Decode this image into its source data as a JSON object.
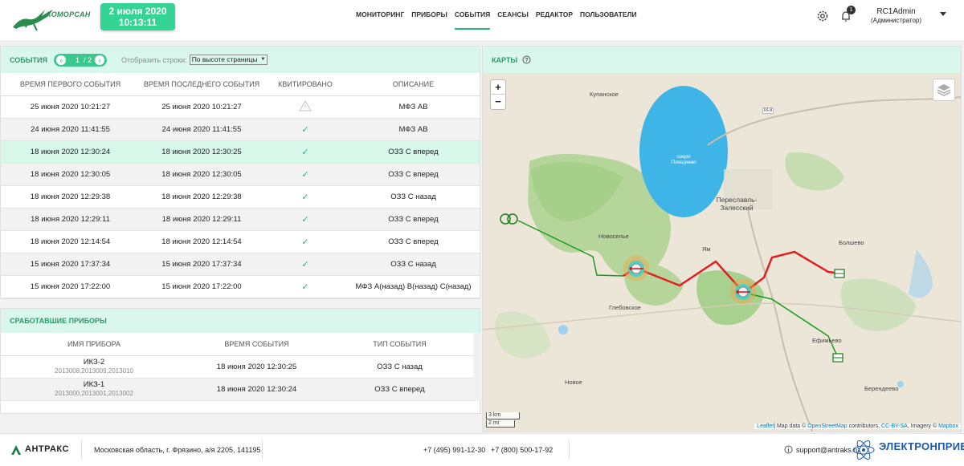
{
  "header": {
    "brand": "КОМОРСАН",
    "date": "2 июля 2020",
    "time": "10:13:11",
    "nav": [
      "МОНИТОРИНГ",
      "ПРИБОРЫ",
      "СОБЫТИЯ",
      "СЕАНСЫ",
      "РЕДАКТОР",
      "ПОЛЬЗОВАТЕЛИ"
    ],
    "notifications": "1",
    "user_name": "RC1Admin",
    "user_role": "(Администратор)"
  },
  "events": {
    "title": "СОБЫТИЯ",
    "page": "1",
    "pages": "/ 2",
    "show_label": "Отобразить строки:",
    "show_value": "По высоте страницы",
    "columns": [
      "ВРЕМЯ ПЕРВОГО СОБЫТИЯ",
      "ВРЕМЯ ПОСЛЕДНЕГО СОБЫТИЯ",
      "КВИТИРОВАНО",
      "ОПИСАНИЕ"
    ],
    "rows": [
      {
        "first": "25 июня 2020 10:21:27",
        "last": "25 июня 2020 10:21:27",
        "ack": "warn",
        "desc": "МФЗ АВ"
      },
      {
        "first": "24 июня 2020 11:41:55",
        "last": "24 июня 2020 11:41:55",
        "ack": "✓",
        "desc": "МФЗ АВ"
      },
      {
        "first": "18 июня 2020 12:30:24",
        "last": "18 июня 2020 12:30:25",
        "ack": "✓",
        "desc": "ОЗЗ С вперед"
      },
      {
        "first": "18 июня 2020 12:30:05",
        "last": "18 июня 2020 12:30:05",
        "ack": "✓",
        "desc": "ОЗЗ С вперед"
      },
      {
        "first": "18 июня 2020 12:29:38",
        "last": "18 июня 2020 12:29:38",
        "ack": "✓",
        "desc": "ОЗЗ С назад"
      },
      {
        "first": "18 июня 2020 12:29:11",
        "last": "18 июня 2020 12:29:11",
        "ack": "✓",
        "desc": "ОЗЗ С вперед"
      },
      {
        "first": "18 июня 2020 12:14:54",
        "last": "18 июня 2020 12:14:54",
        "ack": "✓",
        "desc": "ОЗЗ С вперед"
      },
      {
        "first": "15 июня 2020 17:37:34",
        "last": "15 июня 2020 17:37:34",
        "ack": "✓",
        "desc": "ОЗЗ С назад"
      },
      {
        "first": "15 июня 2020 17:22:00",
        "last": "15 июня 2020 17:22:00",
        "ack": "✓",
        "desc": "МФЗ А(назад) В(назад) С(назад)"
      }
    ]
  },
  "devices": {
    "title": "СРАБОТАВШИЕ ПРИБОРЫ",
    "columns": [
      "ИМЯ ПРИБОРА",
      "ВРЕМЯ СОБЫТИЯ",
      "ТИП СОБЫТИЯ"
    ],
    "rows": [
      {
        "name": "ИКЗ-2",
        "ids": "2013008,2013009,2013010",
        "time": "18 июня 2020 12:30:25",
        "type": "ОЗЗ С назад"
      },
      {
        "name": "ИКЗ-1",
        "ids": "2013000,2013001,2013002",
        "time": "18 июня 2020 12:30:24",
        "type": "ОЗЗ С вперед"
      }
    ]
  },
  "map": {
    "title": "КАРТЫ",
    "zoom_in": "+",
    "zoom_out": "−",
    "labels": [
      "Купанское",
      "озеро Плещеево",
      "Переславль-Залесский",
      "Новоселье",
      "Ям",
      "Болшево",
      "Глебовское",
      "Ефимьево",
      "Новое",
      "Берендеево",
      "М-8"
    ],
    "scale_km": "3 km",
    "scale_mi": "2 mi",
    "attr_leaflet": "Leaflet",
    "attr_text": "| Map data © ",
    "attr_osm": "OpenStreetMap",
    "attr_contrib": " contributors, ",
    "attr_cc": "CC-BY-SA",
    "attr_imagery": ", Imagery © ",
    "attr_mapbox": "Mapbox"
  },
  "footer": {
    "brand": "АНТРАКС",
    "address": "Московская область, г. Фрязино, а/я 2205, 141195",
    "phone1": "+7 (495) 991-12-30",
    "phone2": "+7 (800) 500-17-92",
    "email": "support@antraks.ru",
    "watermark": "ЭЛЕКТРОНПРИБОР"
  },
  "colors": {
    "accent": "#2ab57d",
    "header_bg": "#d9f7ec",
    "highlight": "#d6f7ea",
    "line_red": "#e02020",
    "line_green": "#1a9a1a"
  }
}
